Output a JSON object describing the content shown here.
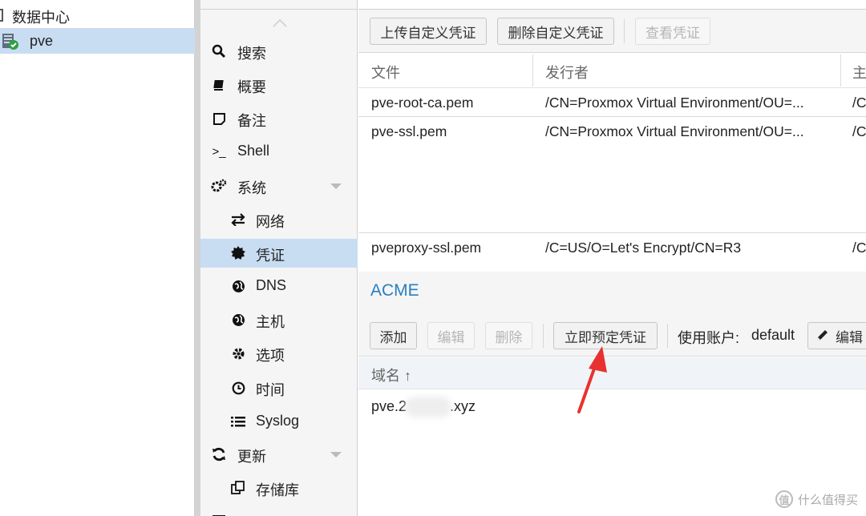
{
  "tree": {
    "datacenter_label": "数据中心",
    "node_label": "pve"
  },
  "nav": {
    "items": [
      {
        "label": "搜索",
        "icon": "search-icon"
      },
      {
        "label": "概要",
        "icon": "book-icon"
      },
      {
        "label": "备注",
        "icon": "note-icon"
      },
      {
        "label": "Shell",
        "icon": "terminal-icon"
      },
      {
        "label": "系统",
        "icon": "gears-icon"
      },
      {
        "label": "网络",
        "icon": "exchange-icon"
      },
      {
        "label": "凭证",
        "icon": "certificate-icon"
      },
      {
        "label": "DNS",
        "icon": "globe-icon"
      },
      {
        "label": "主机",
        "icon": "globe-icon"
      },
      {
        "label": "选项",
        "icon": "gear-icon"
      },
      {
        "label": "时间",
        "icon": "clock-icon"
      },
      {
        "label": "Syslog",
        "icon": "list-icon"
      },
      {
        "label": "更新",
        "icon": "refresh-icon"
      },
      {
        "label": "存储库",
        "icon": "copy-icon"
      }
    ],
    "active_label": "凭证"
  },
  "toolbar": {
    "upload_label": "上传自定义凭证",
    "delete_label": "删除自定义凭证",
    "view_label": "查看凭证"
  },
  "cert_grid": {
    "columns": [
      "文件",
      "发行者",
      "主"
    ],
    "rows": [
      {
        "file": "pve-root-ca.pem",
        "issuer": "/CN=Proxmox Virtual Environment/OU=...",
        "subject": "/C"
      },
      {
        "file": "pve-ssl.pem",
        "issuer": "/CN=Proxmox Virtual Environment/OU=...",
        "subject": "/C"
      },
      {
        "file": "pveproxy-ssl.pem",
        "issuer": "/C=US/O=Let's Encrypt/CN=R3",
        "subject": "/C"
      }
    ]
  },
  "acme": {
    "title": "ACME",
    "add_label": "添加",
    "edit_label": "编辑",
    "remove_label": "删除",
    "order_label": "立即预定凭证",
    "account_prefix": "使用账户:",
    "account_value": "default",
    "account_edit_label": "编辑",
    "domain_column": "域名 ↑",
    "domain_prefix": "pve.2",
    "domain_suffix": ".xyz"
  },
  "watermark": {
    "text": "什么值得买",
    "icon_glyph": "值"
  },
  "colors": {
    "selection": "#c8ddf2",
    "acme_title": "#2a7fc0",
    "annotation_arrow": "#e8322f"
  }
}
